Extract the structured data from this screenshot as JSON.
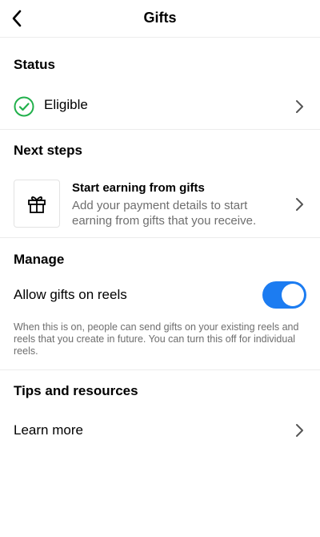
{
  "header": {
    "title": "Gifts",
    "back_icon": "chevron-left-icon"
  },
  "status": {
    "heading": "Status",
    "value": "Eligible",
    "icon": "check-circle-icon",
    "icon_color": "#21b04b"
  },
  "next_steps": {
    "heading": "Next steps",
    "item_title": "Start earning from gifts",
    "item_description": "Add your payment details to start earning from gifts that you receive.",
    "icon": "gift-icon"
  },
  "manage": {
    "heading": "Manage",
    "toggle_label": "Allow gifts on reels",
    "toggle_on": true,
    "toggle_color": "#1c7cf1",
    "help_text": "When this is on, people can send gifts on your existing reels and reels that you create in future. You can turn this off for individual reels."
  },
  "tips": {
    "heading": "Tips and resources",
    "learn_more": "Learn more"
  }
}
